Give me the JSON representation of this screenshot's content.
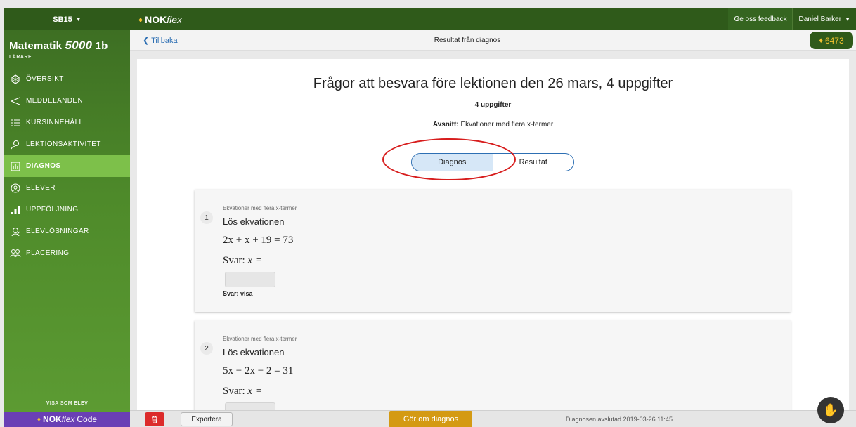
{
  "sidebar": {
    "class_select": "SB15",
    "course_title": "Matematik",
    "course_number": "5000",
    "course_level": "1b",
    "role": "LÄRARE",
    "items": [
      {
        "label": "ÖVERSIKT",
        "icon": "overview-icon",
        "active": false
      },
      {
        "label": "MEDDELANDEN",
        "icon": "message-icon",
        "active": false
      },
      {
        "label": "KURSINNEHÅLL",
        "icon": "list-icon",
        "active": false
      },
      {
        "label": "LEKTIONSAKTIVITET",
        "icon": "activity-icon",
        "active": false
      },
      {
        "label": "DIAGNOS",
        "icon": "diagnos-icon",
        "active": true
      },
      {
        "label": "ELEVER",
        "icon": "student-icon",
        "active": false
      },
      {
        "label": "UPPFÖLJNING",
        "icon": "bar-chart-icon",
        "active": false
      },
      {
        "label": "ELEVLÖSNINGAR",
        "icon": "solutions-icon",
        "active": false
      },
      {
        "label": "PLACERING",
        "icon": "placement-icon",
        "active": false
      }
    ],
    "visa_som_elev": "VISA SOM ELEV",
    "code_brand": "NOK",
    "code_flex": "flex",
    "code_suffix": "Code"
  },
  "topbar": {
    "brand": "NOK",
    "brand_flex": "flex",
    "feedback": "Ge oss feedback",
    "user": "Daniel Barker"
  },
  "subheader": {
    "back": "Tillbaka",
    "title": "Resultat från diagnos",
    "coins": "6473"
  },
  "main": {
    "headline": "Frågor att besvara före lektionen den 26 mars, 4 uppgifter",
    "count": "4 uppgifter",
    "section_label": "Avsnitt:",
    "section_value": "Ekvationer med flera x-termer",
    "tabs": [
      "Diagnos",
      "Resultat"
    ],
    "active_tab": "Diagnos"
  },
  "questions": [
    {
      "number": "1",
      "category": "Ekvationer med flera x-termer",
      "prompt": "Lös ekvationen",
      "equation": "2x + x + 19 = 73",
      "answer_label": "Svar:",
      "answer_var": "x =",
      "reveal": "Svar: visa"
    },
    {
      "number": "2",
      "category": "Ekvationer med flera x-termer",
      "prompt": "Lös ekvationen",
      "equation": "5x − 2x − 2 = 31",
      "answer_label": "Svar:",
      "answer_var": "x ="
    }
  ],
  "footer": {
    "export": "Exportera",
    "redo": "Gör om diagnos",
    "status": "Diagnosen avslutad 2019-03-26 11:45"
  },
  "colors": {
    "sidebar_green": "#4e8a2a",
    "topbar_green": "#2f5a1a",
    "active_nav": "#7dc04a",
    "accent_blue": "#2d6fb3",
    "redo_gold": "#d49a13",
    "trash_red": "#dc2b2b",
    "highlight_ring": "#d71d1d"
  }
}
